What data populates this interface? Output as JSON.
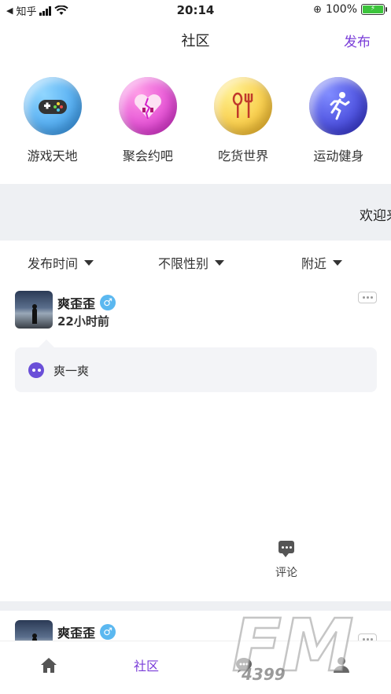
{
  "status_bar": {
    "back_app": "知乎",
    "time": "20:14",
    "battery_percent": "100%",
    "icons": [
      "back-arrow-icon",
      "signal-icon",
      "wifi-icon",
      "orientation-lock-icon",
      "battery-icon"
    ]
  },
  "nav": {
    "title": "社区",
    "publish_label": "发布"
  },
  "categories": [
    {
      "label": "游戏天地",
      "icon": "gamepad-icon",
      "color_from": "#8fd6ff",
      "color_to": "#2a8fe6"
    },
    {
      "label": "聚会约吧",
      "icon": "broken-heart-icon",
      "color_from": "#ff9ae6",
      "color_to": "#d21ec9"
    },
    {
      "label": "吃货世界",
      "icon": "spoon-fork-icon",
      "color_from": "#fff08a",
      "color_to": "#f3b21c"
    },
    {
      "label": "运动健身",
      "icon": "runner-icon",
      "color_from": "#7f8bff",
      "color_to": "#2a28c8"
    }
  ],
  "banner": {
    "text": "欢迎来"
  },
  "filters": [
    {
      "label": "发布时间"
    },
    {
      "label": "不限性别"
    },
    {
      "label": "附近"
    }
  ],
  "posts": [
    {
      "username": "爽歪歪",
      "gender_symbol": "♂",
      "time_ago": "22小时前",
      "content": "爽一爽",
      "comment_label": "评论"
    },
    {
      "username": "爽歪歪",
      "gender_symbol": "♂"
    }
  ],
  "tabbar": {
    "community_label": "社区",
    "icons": [
      "home-icon",
      "message-icon",
      "profile-icon"
    ]
  },
  "watermark": {
    "text": "FM",
    "subtext": "4399"
  },
  "colors": {
    "accent": "#7a3dd8",
    "banner_bg": "#eef0f3",
    "gender_male": "#5bb8f0"
  }
}
